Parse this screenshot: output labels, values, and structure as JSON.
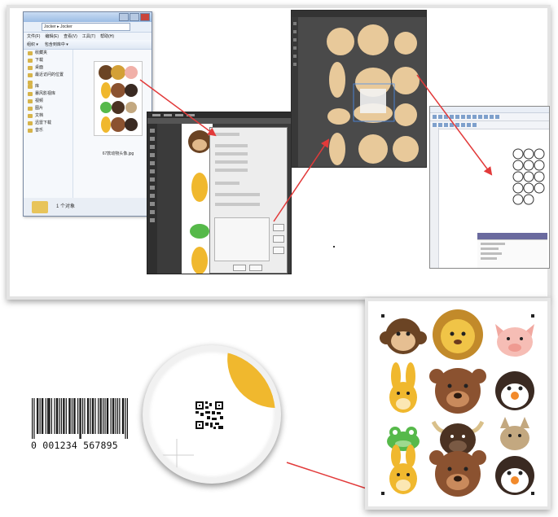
{
  "explorer": {
    "address": "Jocker ▸ Jocker",
    "menu": [
      "文件(F)",
      "编辑(E)",
      "查看(V)",
      "工具(T)",
      "帮助(H)"
    ],
    "toolbar": [
      "组织 ▾",
      "包含到库中 ▾"
    ],
    "nav_items": [
      "收藏夹",
      "下载",
      "桌面",
      "最近访问的位置",
      "库",
      "暴风影视库",
      "视频",
      "图片",
      "文档",
      "迅雷下载",
      "音乐"
    ],
    "file_label": "67款动物头像.jpg",
    "status": "1 个对象"
  },
  "barcode": {
    "digits": "0 001234 567895"
  },
  "colors": {
    "accent_yellow": "#f0b82e",
    "frame_border": "#e3e3e3",
    "arrow_red": "#e23a3a",
    "illustrator_bg": "#4a4a4a",
    "shape_tan": "#e8c99a"
  },
  "icons": {
    "qr": "qr-code-icon",
    "crosshair": "registration-crosshair-icon",
    "arrow": "red-arrow-icon"
  }
}
